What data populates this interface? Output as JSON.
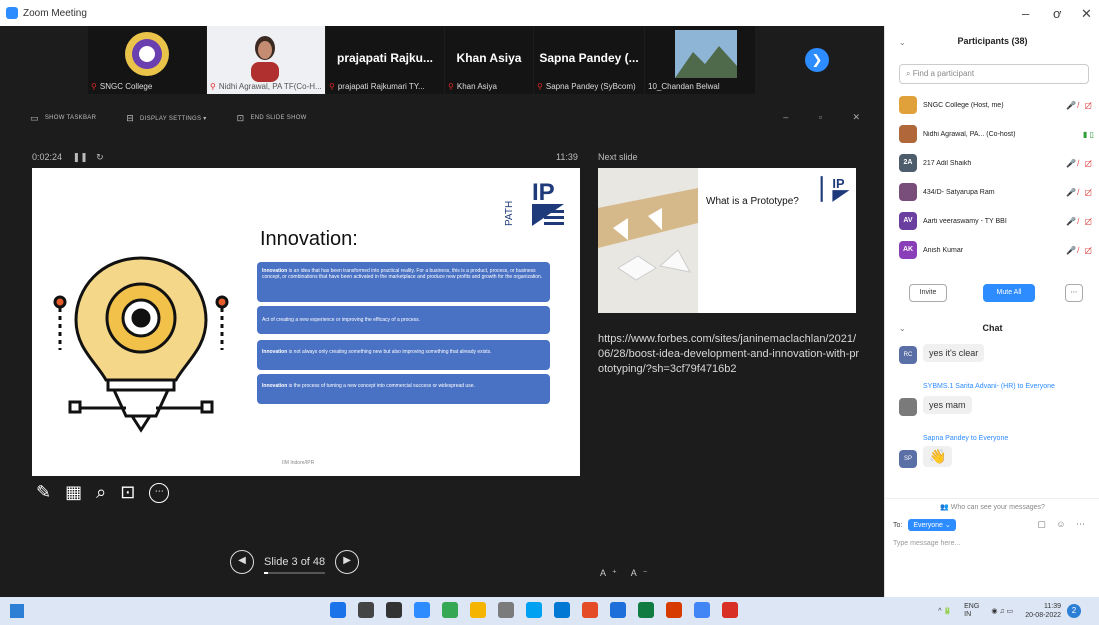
{
  "window": {
    "title": "Zoom Meeting",
    "min": "–",
    "restore": "ơ",
    "close": "✕"
  },
  "thumbnails": [
    {
      "label": "SNGC College",
      "name": ""
    },
    {
      "label": "Nidhi Agrawal, PA TF(Co-H...",
      "name": ""
    },
    {
      "label": "prajapati Rajkumari TY...",
      "name": "prajapati Rajku..."
    },
    {
      "label": "Khan Asiya",
      "name": "Khan Asiya"
    },
    {
      "label": "Sapna Pandey (SyBcom)",
      "name": "Sapna Pandey (..."
    },
    {
      "label": "10_Chandan Belwal",
      "name": ""
    }
  ],
  "toolbar": {
    "show_taskbar": "SHOW TASKBAR",
    "display_settings": "DISPLAY SETTINGS ▾",
    "end_slide_show": "END SLIDE SHOW"
  },
  "presenter": {
    "timer": "0:02:24",
    "pause": "❚❚",
    "reset": "↻",
    "clock": "11:39",
    "next_slide_label": "Next slide",
    "notes": "https://www.forbes.com/sites/janinemaclachlan/2021/06/28/boost-idea-development-and-innovation-with-prototyping/?sh=3cf79f4716b2",
    "slide_counter": "Slide 3 of 48",
    "progress_fraction": 0.0625,
    "font_size": "A⁺ A⁻"
  },
  "slide": {
    "title": "Innovation:",
    "logo_text": "IP PATH",
    "boxes": [
      {
        "bold": "Innovation",
        "text": " is an idea that has been transformed into practical reality. For a business, this is a product, process, or business concept, or combinations that have been activated in the marketplace and produce new profits and growth for the organization."
      },
      {
        "bold": "",
        "text": "Act of creating a new experience or improving the efficacy of a process."
      },
      {
        "bold": "Innovation",
        "text": " is not always only creating something new but also improving something that already exists."
      },
      {
        "bold": "Innovation",
        "text": " is the process of turning a new concept into commercial success or widespread use."
      }
    ],
    "footer": "IIM Indore/IPR"
  },
  "next_slide": {
    "title": "What is a Prototype?"
  },
  "tools": [
    "✎",
    "▦",
    "⌕",
    "⊡",
    "⋯"
  ],
  "panel": {
    "participants_title": "Participants (38)",
    "search_placeholder": "Find a participant",
    "participants": [
      {
        "initials": "",
        "name": "SNGC College (Host, me)",
        "color": "#e0a13a"
      },
      {
        "initials": "",
        "name": "Nidhi Agrawal, PA... (Co-host)",
        "color": "#b0673a"
      },
      {
        "initials": "2A",
        "name": "217 Adil Shaikh",
        "color": "#4d5d6b"
      },
      {
        "initials": "",
        "name": "434/D- Satyarupa Ram",
        "color": "#7a4e7a"
      },
      {
        "initials": "AV",
        "name": "Aarti veeraswamy - TY BBI",
        "color": "#6b3fa0"
      },
      {
        "initials": "AK",
        "name": "Anish Kumar",
        "color": "#8a3fb8"
      }
    ],
    "status_icons": "🎤̸ ▢̸",
    "invite": "Invite",
    "mute_all": "Mute All",
    "more": "⋯",
    "chat_title": "Chat",
    "messages": [
      {
        "sender": "",
        "avatar": "RC",
        "text": "yes it's clear"
      },
      {
        "sender": "SYBMS.1 Sarita Advani- (HR) to Everyone",
        "avatar": "",
        "text": "yes mam"
      },
      {
        "sender": "Sapna Pandey to Everyone",
        "avatar": "SP",
        "text": "👋"
      }
    ],
    "who_can_see": "Who can see your messages?",
    "to_label": "To:",
    "to_value": "Everyone ⌄",
    "type_placeholder": "Type message here..."
  },
  "taskbar": {
    "lang": "ENG\nIN",
    "time": "11:39",
    "date": "20-08-2022",
    "icon_colors": [
      "#1a73e8",
      "#444",
      "#333",
      "#2d8cff",
      "#34a853",
      "#f4b400",
      "#7b7b7b",
      "#00a1f1",
      "#0078d4",
      "#e34c26",
      "#1e6fd9",
      "#107c41",
      "#d83b01",
      "#4285f4",
      "#d93025"
    ]
  },
  "colors": {
    "accent": "#2d8cff",
    "box_blue": "#4a72c4",
    "mic_red": "#e02828"
  }
}
